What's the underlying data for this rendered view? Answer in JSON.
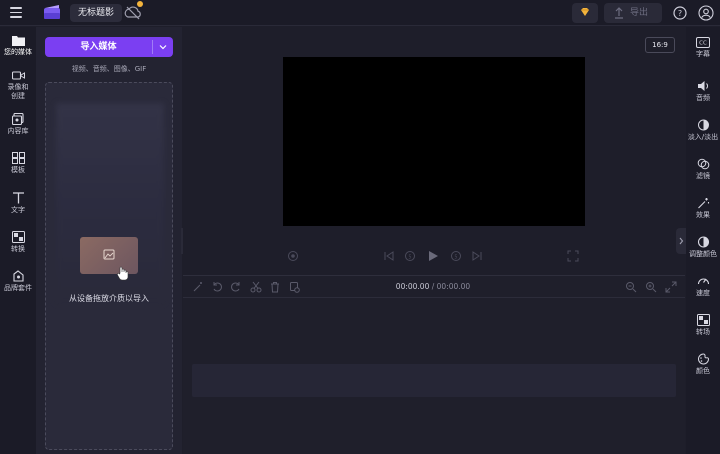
{
  "topbar": {
    "project_title": "无标题影",
    "export_label": "导出"
  },
  "left_nav": [
    {
      "label": "您的媒体",
      "icon": "folder-icon"
    },
    {
      "label": "录像和创建",
      "icon": "video-camera-icon"
    },
    {
      "label": "内容库",
      "icon": "content-library-icon"
    },
    {
      "label": "模板",
      "icon": "templates-icon"
    },
    {
      "label": "文字",
      "icon": "text-icon"
    },
    {
      "label": "转换",
      "icon": "transitions-icon"
    },
    {
      "label": "品牌套件",
      "icon": "brand-kit-icon"
    }
  ],
  "media_panel": {
    "import_label": "导入媒体",
    "formats_text": "视频、音频、图像、GIF",
    "drop_text": "从设备拖放介质以导入"
  },
  "preview": {
    "aspect_ratio": "16:9"
  },
  "timeline": {
    "current_time": "00:00.00",
    "total_time": " / 00:00.00"
  },
  "right_nav": [
    {
      "label": "字幕",
      "icon": "captions-icon"
    },
    {
      "label": "音频",
      "icon": "audio-icon"
    },
    {
      "label": "淡入/淡出",
      "icon": "fade-icon"
    },
    {
      "label": "滤镜",
      "icon": "filters-icon"
    },
    {
      "label": "效果",
      "icon": "effects-icon"
    },
    {
      "label": "调整颜色",
      "icon": "adjust-colors-icon"
    },
    {
      "label": "速度",
      "icon": "speed-icon"
    },
    {
      "label": "转场",
      "icon": "transition-icon"
    },
    {
      "label": "颜色",
      "icon": "color-icon"
    }
  ],
  "colors": {
    "accent": "#7b3ff2",
    "background": "#1e1e2a",
    "panel": "#232331",
    "premium": "#f4b43c"
  }
}
